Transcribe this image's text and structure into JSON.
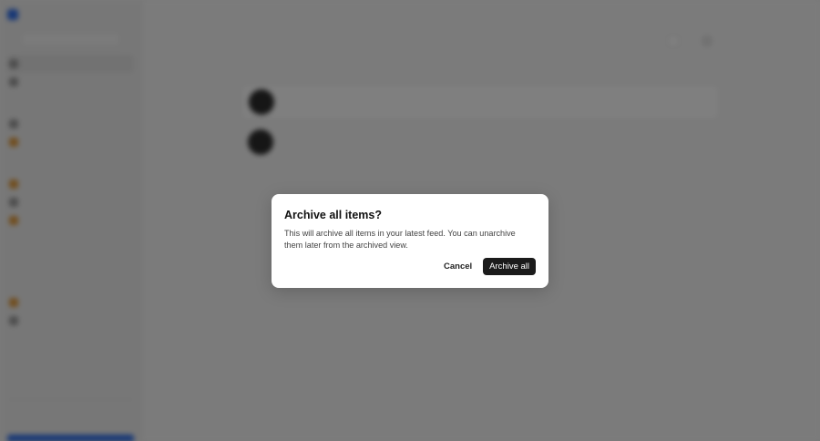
{
  "background": {
    "sidebar": {
      "workspace": "",
      "new_button": "",
      "items_top": [
        "",
        ""
      ],
      "section_a": "",
      "items_a": [
        "",
        ""
      ],
      "section_b": "",
      "items_b": [
        "",
        "",
        ""
      ],
      "section_c": "",
      "muted_c": "",
      "section_d": "",
      "items_d": [
        "",
        ""
      ],
      "footer_title": "",
      "footer_sub": ""
    },
    "main": {
      "title": "",
      "toolbar": [
        "",
        ""
      ],
      "section_label": "",
      "cards": [
        {
          "title": "",
          "subtitle": "",
          "meta": ""
        },
        {
          "title": "",
          "subtitle": "",
          "meta": ""
        }
      ]
    }
  },
  "dialog": {
    "title": "Archive all items?",
    "body": "This will archive all items in your latest feed. You can unarchive them later from the archived view.",
    "cancel_label": "Cancel",
    "confirm_label": "Archive all"
  },
  "colors": {
    "overlay": "#808080",
    "confirm_bg": "#1b1b1b",
    "brand": "#2f6feb",
    "accent_orange": "#e29a3a"
  }
}
